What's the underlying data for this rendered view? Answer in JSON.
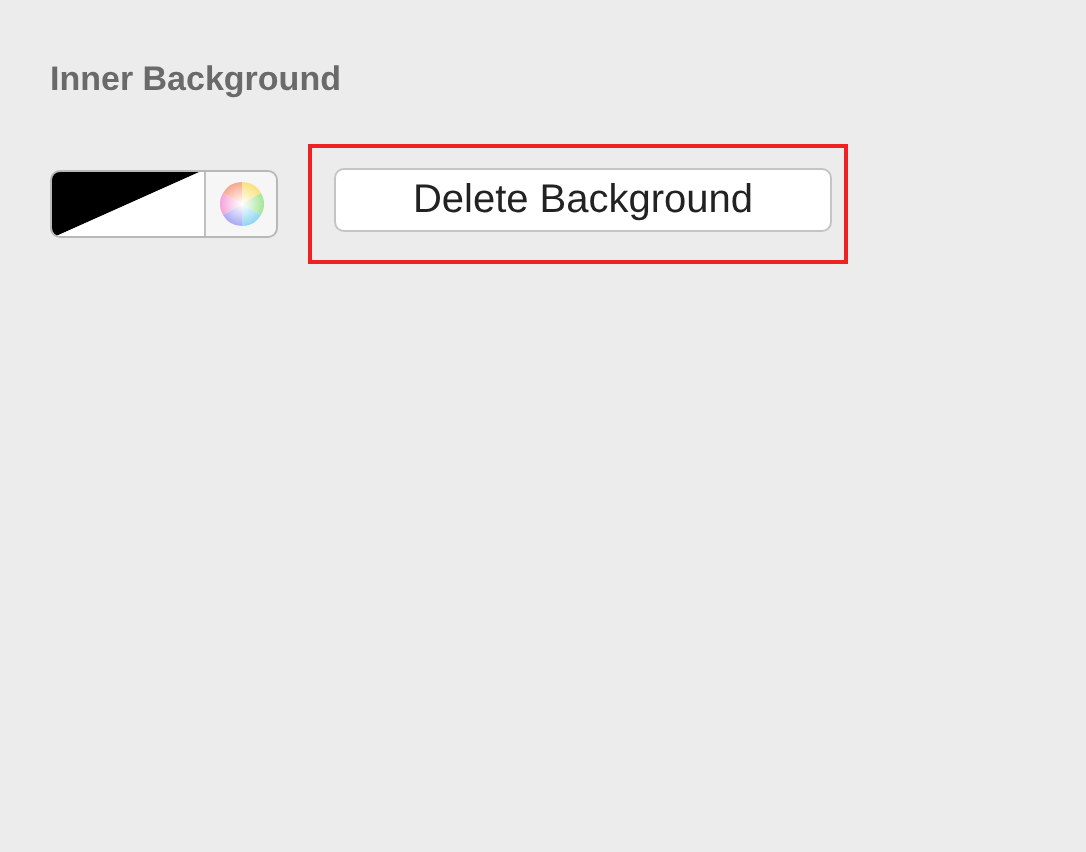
{
  "section": {
    "title": "Inner Background"
  },
  "color_well": {
    "kind": "gradient"
  },
  "delete_button": {
    "label": "Delete Background",
    "highlighted": true
  }
}
